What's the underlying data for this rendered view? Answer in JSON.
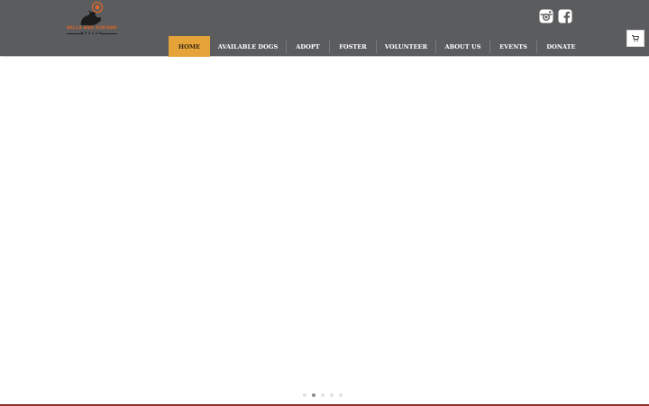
{
  "brand": {
    "name": "BELLA AND ZOKIANE",
    "sub": "RESCUE",
    "accent_color": "#d9662b"
  },
  "social": [
    {
      "icon": "instagram-icon"
    },
    {
      "icon": "facebook-icon"
    }
  ],
  "nav": {
    "active_color": "#e6a33a",
    "items": [
      {
        "label": "HOME",
        "active": true
      },
      {
        "label": "AVAILABLE DOGS"
      },
      {
        "label": "ADOPT"
      },
      {
        "label": "FOSTER"
      },
      {
        "label": "VOLUNTEER"
      },
      {
        "label": "ABOUT US"
      },
      {
        "label": "EVENTS"
      },
      {
        "label": "DONATE"
      }
    ]
  },
  "cart": {
    "icon": "cart-icon"
  },
  "slider": {
    "slide_count": 5,
    "active_index": 1
  },
  "colors": {
    "header": "#5b5c5e",
    "bottom_bar": "#8e2b2b"
  }
}
